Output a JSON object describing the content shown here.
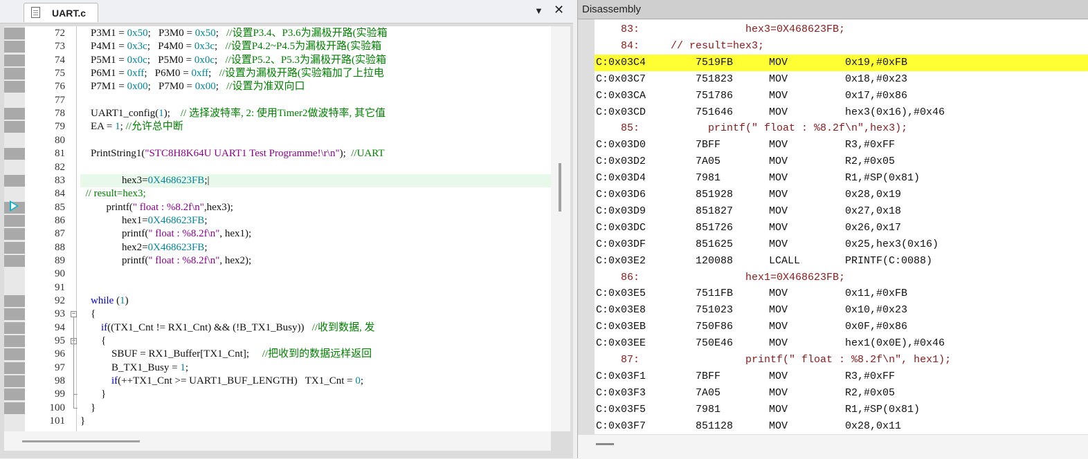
{
  "editor": {
    "tab_label": "UART.c",
    "dropdown_glyph": "▼",
    "close_glyph": "✕",
    "lines": [
      {
        "n": "72",
        "html": "    P3M1 = <span class=\"num\">0x50</span>;   P3M0 = <span class=\"num\">0x50</span>;   <span class=\"cmt\">//设置P3.4、P3.6为漏极开路(实验箱</span>"
      },
      {
        "n": "73",
        "html": "    P4M1 = <span class=\"num\">0x3c</span>;   P4M0 = <span class=\"num\">0x3c</span>;   <span class=\"cmt\">//设置P4.2~P4.5为漏极开路(实验箱</span>"
      },
      {
        "n": "74",
        "html": "    P5M1 = <span class=\"num\">0x0c</span>;   P5M0 = <span class=\"num\">0x0c</span>;   <span class=\"cmt\">//设置P5.2、P5.3为漏极开路(实验箱</span>"
      },
      {
        "n": "75",
        "html": "    P6M1 = <span class=\"num\">0xff</span>;   P6M0 = <span class=\"num\">0xff</span>;   <span class=\"cmt\">//设置为漏极开路(实验箱加了上拉电</span>"
      },
      {
        "n": "76",
        "html": "    P7M1 = <span class=\"num\">0x00</span>;   P7M0 = <span class=\"num\">0x00</span>;   <span class=\"cmt\">//设置为准双向口</span>"
      },
      {
        "n": "77",
        "html": ""
      },
      {
        "n": "78",
        "html": "    UART1_config(<span class=\"num\">1</span>);    <span class=\"cmt\">// 选择波特率, 2: 使用Timer2做波特率, 其它值</span>"
      },
      {
        "n": "79",
        "html": "    EA = <span class=\"num\">1</span>; <span class=\"cmt\">//允许总中断</span>"
      },
      {
        "n": "80",
        "html": ""
      },
      {
        "n": "81",
        "html": "    PrintString1(<span class=\"str\">\"STC8H8K64U UART1 Test Programme!\\r\\n\"</span>);  <span class=\"cmt\">//UART</span>"
      },
      {
        "n": "82",
        "html": ""
      },
      {
        "n": "83",
        "html": "                hex3=<span class=\"num\">0X468623FB</span>;|"
      },
      {
        "n": "84",
        "html": "  <span class=\"cmt\">// result=hex3;</span>"
      },
      {
        "n": "85",
        "html": "          printf(<span class=\"str\">\" float : %8.2f\\n\"</span>,hex3);"
      },
      {
        "n": "86",
        "html": "                hex1=<span class=\"num\">0X468623FB</span>;"
      },
      {
        "n": "87",
        "html": "                printf(<span class=\"str\">\" float : %8.2f\\n\"</span>, hex1);"
      },
      {
        "n": "88",
        "html": "                hex2=<span class=\"num\">0X468623FB</span>;"
      },
      {
        "n": "89",
        "html": "                printf(<span class=\"str\">\" float : %8.2f\\n\"</span>, hex2);"
      },
      {
        "n": "90",
        "html": ""
      },
      {
        "n": "91",
        "html": ""
      },
      {
        "n": "92",
        "html": "    <span class=\"kw\">while</span> (<span class=\"num\">1</span>)"
      },
      {
        "n": "93",
        "html": "    {"
      },
      {
        "n": "94",
        "html": "        <span class=\"kw\">if</span>((TX1_Cnt != RX1_Cnt) &amp;&amp; (!B_TX1_Busy))   <span class=\"cmt\">//收到数据, 发</span>"
      },
      {
        "n": "95",
        "html": "        {"
      },
      {
        "n": "96",
        "html": "            SBUF = RX1_Buffer[TX1_Cnt];     <span class=\"cmt\">//把收到的数据远样返回</span>"
      },
      {
        "n": "97",
        "html": "            B_TX1_Busy = <span class=\"num\">1</span>;"
      },
      {
        "n": "98",
        "html": "            <span class=\"kw\">if</span>(++TX1_Cnt &gt;= UART1_BUF_LENGTH)   TX1_Cnt = <span class=\"num\">0</span>;"
      },
      {
        "n": "99",
        "html": "        }"
      },
      {
        "n": "100",
        "html": "    }"
      },
      {
        "n": "101",
        "html": "}"
      }
    ]
  },
  "disassembly": {
    "title": "Disassembly",
    "lines": [
      {
        "kind": "src",
        "text": "    83:                 hex3=0X468623FB;"
      },
      {
        "kind": "src",
        "text": "    84:     // result=hex3;"
      },
      {
        "kind": "asm",
        "addr": "C:0x03C4",
        "op": "7519FB",
        "mn": "MOV",
        "args": "0x19,#0xFB",
        "hl": true
      },
      {
        "kind": "asm",
        "addr": "C:0x03C7",
        "op": "751823",
        "mn": "MOV",
        "args": "0x18,#0x23"
      },
      {
        "kind": "asm",
        "addr": "C:0x03CA",
        "op": "751786",
        "mn": "MOV",
        "args": "0x17,#0x86"
      },
      {
        "kind": "asm",
        "addr": "C:0x03CD",
        "op": "751646",
        "mn": "MOV",
        "args": "hex3(0x16),#0x46"
      },
      {
        "kind": "src",
        "text": "    85:           printf(\" float : %8.2f\\n\",hex3);"
      },
      {
        "kind": "asm",
        "addr": "C:0x03D0",
        "op": "7BFF",
        "mn": "MOV",
        "args": "R3,#0xFF"
      },
      {
        "kind": "asm",
        "addr": "C:0x03D2",
        "op": "7A05",
        "mn": "MOV",
        "args": "R2,#0x05"
      },
      {
        "kind": "asm",
        "addr": "C:0x03D4",
        "op": "7981",
        "mn": "MOV",
        "args": "R1,#SP(0x81)"
      },
      {
        "kind": "asm",
        "addr": "C:0x03D6",
        "op": "851928",
        "mn": "MOV",
        "args": "0x28,0x19"
      },
      {
        "kind": "asm",
        "addr": "C:0x03D9",
        "op": "851827",
        "mn": "MOV",
        "args": "0x27,0x18"
      },
      {
        "kind": "asm",
        "addr": "C:0x03DC",
        "op": "851726",
        "mn": "MOV",
        "args": "0x26,0x17"
      },
      {
        "kind": "asm",
        "addr": "C:0x03DF",
        "op": "851625",
        "mn": "MOV",
        "args": "0x25,hex3(0x16)"
      },
      {
        "kind": "asm",
        "addr": "C:0x03E2",
        "op": "120088",
        "mn": "LCALL",
        "args": "PRINTF(C:0088)"
      },
      {
        "kind": "src",
        "text": "    86:                 hex1=0X468623FB;"
      },
      {
        "kind": "asm",
        "addr": "C:0x03E5",
        "op": "7511FB",
        "mn": "MOV",
        "args": "0x11,#0xFB"
      },
      {
        "kind": "asm",
        "addr": "C:0x03E8",
        "op": "751023",
        "mn": "MOV",
        "args": "0x10,#0x23"
      },
      {
        "kind": "asm",
        "addr": "C:0x03EB",
        "op": "750F86",
        "mn": "MOV",
        "args": "0x0F,#0x86"
      },
      {
        "kind": "asm",
        "addr": "C:0x03EE",
        "op": "750E46",
        "mn": "MOV",
        "args": "hex1(0x0E),#0x46"
      },
      {
        "kind": "src",
        "text": "    87:                 printf(\" float : %8.2f\\n\", hex1);"
      },
      {
        "kind": "asm",
        "addr": "C:0x03F1",
        "op": "7BFF",
        "mn": "MOV",
        "args": "R3,#0xFF"
      },
      {
        "kind": "asm",
        "addr": "C:0x03F3",
        "op": "7A05",
        "mn": "MOV",
        "args": "R2,#0x05"
      },
      {
        "kind": "asm",
        "addr": "C:0x03F5",
        "op": "7981",
        "mn": "MOV",
        "args": "R1,#SP(0x81)"
      },
      {
        "kind": "asm",
        "addr": "C:0x03F7",
        "op": "851128",
        "mn": "MOV",
        "args": "0x28,0x11"
      }
    ]
  },
  "colors": {
    "highlight": "#ffff33",
    "current_line": "#e8f8ea",
    "source_text": "#8b1a1a",
    "number": "#00869b",
    "string": "#8b008b",
    "comment": "#008000",
    "keyword": "#0000e0"
  },
  "icons": {
    "file_tab": "file-icon",
    "execution_pointer": "current-line-arrow-icon"
  }
}
